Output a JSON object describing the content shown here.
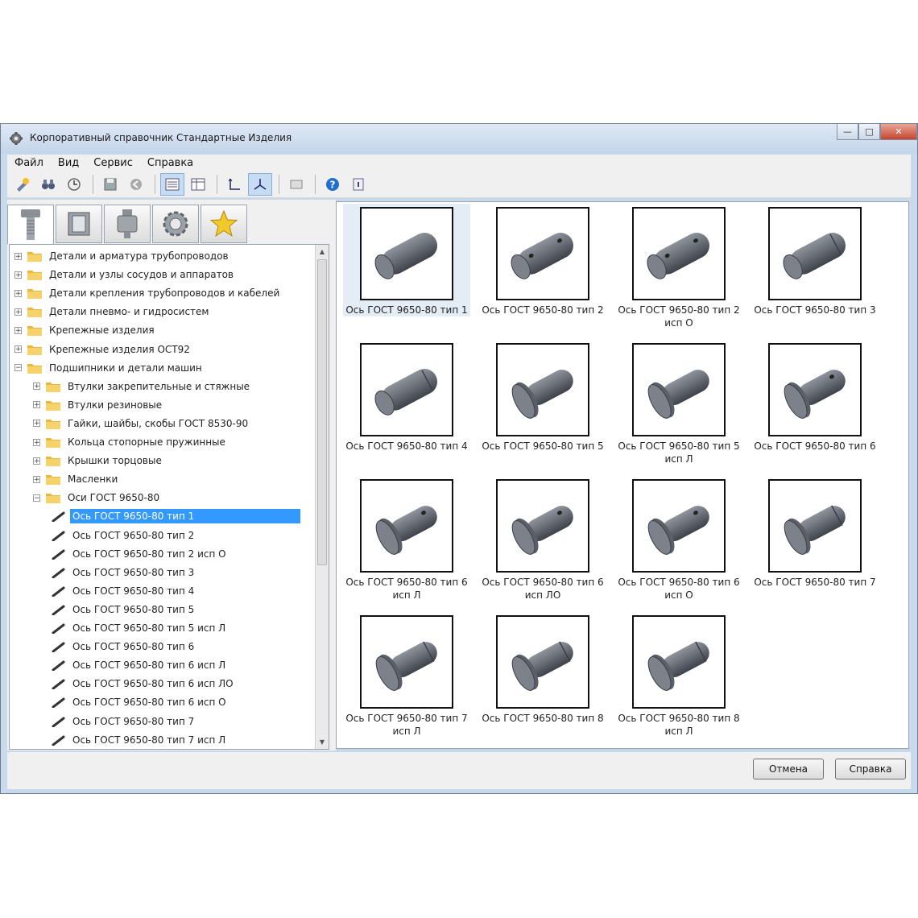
{
  "window": {
    "title": "Корпоративный справочник Стандартные Изделия"
  },
  "menu": [
    "Файл",
    "Вид",
    "Сервис",
    "Справка"
  ],
  "toolbar_icons": [
    "add-icon",
    "binoculars-icon",
    "clock-icon",
    "save-icon",
    "back-icon",
    "list-view-icon",
    "table-view-icon",
    "axis-2d-icon",
    "axis-3d-icon",
    "preview-icon",
    "help-icon",
    "info-icon"
  ],
  "tabs": [
    "bolt-tab-icon",
    "book-tab-icon",
    "bearing-tab-icon",
    "gear-tab-icon",
    "star-tab-icon"
  ],
  "tree": [
    {
      "label": "Детали и арматура трубопроводов",
      "level": 0,
      "kind": "folder",
      "exp": "+"
    },
    {
      "label": "Детали и узлы сосудов и аппаратов",
      "level": 0,
      "kind": "folder",
      "exp": "+"
    },
    {
      "label": "Детали крепления трубопроводов и кабелей",
      "level": 0,
      "kind": "folder",
      "exp": "+"
    },
    {
      "label": "Детали пневмо- и гидросистем",
      "level": 0,
      "kind": "folder",
      "exp": "+"
    },
    {
      "label": "Крепежные изделия",
      "level": 0,
      "kind": "folder",
      "exp": "+"
    },
    {
      "label": "Крепежные изделия ОСТ92",
      "level": 0,
      "kind": "folder",
      "exp": "+"
    },
    {
      "label": "Подшипники и детали машин",
      "level": 0,
      "kind": "folder",
      "exp": "−"
    },
    {
      "label": "Втулки закрепительные и стяжные",
      "level": 1,
      "kind": "folder",
      "exp": "+"
    },
    {
      "label": "Втулки резиновые",
      "level": 1,
      "kind": "folder",
      "exp": "+"
    },
    {
      "label": "Гайки, шайбы, скобы ГОСТ 8530-90",
      "level": 1,
      "kind": "folder",
      "exp": "+"
    },
    {
      "label": "Кольца стопорные пружинные",
      "level": 1,
      "kind": "folder",
      "exp": "+"
    },
    {
      "label": "Крышки торцовые",
      "level": 1,
      "kind": "folder",
      "exp": "+"
    },
    {
      "label": "Масленки",
      "level": 1,
      "kind": "folder",
      "exp": "+"
    },
    {
      "label": "Оси ГОСТ 9650-80",
      "level": 1,
      "kind": "folder",
      "exp": "−"
    },
    {
      "label": "Ось ГОСТ 9650-80 тип 1",
      "level": 2,
      "kind": "part",
      "selected": true
    },
    {
      "label": "Ось ГОСТ 9650-80 тип 2",
      "level": 2,
      "kind": "part"
    },
    {
      "label": "Ось ГОСТ 9650-80 тип 2 исп О",
      "level": 2,
      "kind": "part"
    },
    {
      "label": "Ось ГОСТ 9650-80 тип 3",
      "level": 2,
      "kind": "part"
    },
    {
      "label": "Ось ГОСТ 9650-80 тип 4",
      "level": 2,
      "kind": "part"
    },
    {
      "label": "Ось ГОСТ 9650-80 тип 5",
      "level": 2,
      "kind": "part"
    },
    {
      "label": "Ось ГОСТ 9650-80 тип 5 исп Л",
      "level": 2,
      "kind": "part"
    },
    {
      "label": "Ось ГОСТ 9650-80 тип 6",
      "level": 2,
      "kind": "part"
    },
    {
      "label": "Ось ГОСТ 9650-80 тип 6  исп Л",
      "level": 2,
      "kind": "part"
    },
    {
      "label": "Ось ГОСТ 9650-80 тип 6 исп ЛО",
      "level": 2,
      "kind": "part"
    },
    {
      "label": "Ось ГОСТ 9650-80 тип 6 исп О",
      "level": 2,
      "kind": "part"
    },
    {
      "label": "Ось ГОСТ 9650-80 тип 7",
      "level": 2,
      "kind": "part"
    },
    {
      "label": "Ось ГОСТ 9650-80 тип 7 исп Л",
      "level": 2,
      "kind": "part"
    }
  ],
  "gallery": [
    {
      "l1": "Ось ГОСТ 9650-80 тип 1",
      "l2": "",
      "head": false,
      "holes": 0,
      "groove": false,
      "selected": true
    },
    {
      "l1": "Ось ГОСТ 9650-80 тип 2",
      "l2": "",
      "head": false,
      "holes": 2,
      "groove": false
    },
    {
      "l1": "Ось ГОСТ 9650-80 тип 2",
      "l2": "исп О",
      "head": false,
      "holes": 2,
      "groove": false
    },
    {
      "l1": "Ось ГОСТ 9650-80 тип 3",
      "l2": "",
      "head": false,
      "holes": 0,
      "groove": true
    },
    {
      "l1": "Ось ГОСТ 9650-80 тип 4",
      "l2": "",
      "head": false,
      "holes": 0,
      "groove": true
    },
    {
      "l1": "Ось ГОСТ 9650-80 тип 5",
      "l2": "",
      "head": true,
      "holes": 0,
      "groove": false
    },
    {
      "l1": "Ось ГОСТ 9650-80 тип 5",
      "l2": "исп Л",
      "head": true,
      "holes": 0,
      "groove": false
    },
    {
      "l1": "Ось ГОСТ 9650-80 тип 6",
      "l2": "",
      "head": true,
      "holes": 1,
      "groove": false
    },
    {
      "l1": "Ось ГОСТ 9650-80 тип 6",
      "l2": "исп Л",
      "head": true,
      "holes": 1,
      "groove": false
    },
    {
      "l1": "Ось ГОСТ 9650-80 тип 6",
      "l2": "исп ЛО",
      "head": true,
      "holes": 1,
      "groove": false
    },
    {
      "l1": "Ось ГОСТ 9650-80 тип 6",
      "l2": "исп О",
      "head": true,
      "holes": 1,
      "groove": false
    },
    {
      "l1": "Ось ГОСТ 9650-80 тип 7",
      "l2": "",
      "head": true,
      "holes": 0,
      "groove": true
    },
    {
      "l1": "Ось ГОСТ 9650-80 тип 7",
      "l2": "исп Л",
      "head": true,
      "holes": 0,
      "groove": true
    },
    {
      "l1": "Ось ГОСТ 9650-80 тип 8",
      "l2": "",
      "head": true,
      "holes": 0,
      "groove": true
    },
    {
      "l1": "Ось ГОСТ 9650-80 тип 8",
      "l2": "исп Л",
      "head": true,
      "holes": 0,
      "groove": true
    }
  ],
  "buttons": {
    "cancel": "Отмена",
    "help": "Справка"
  },
  "colors": {
    "selection": "#3399ff",
    "window_frame": "#c9d9ec"
  }
}
